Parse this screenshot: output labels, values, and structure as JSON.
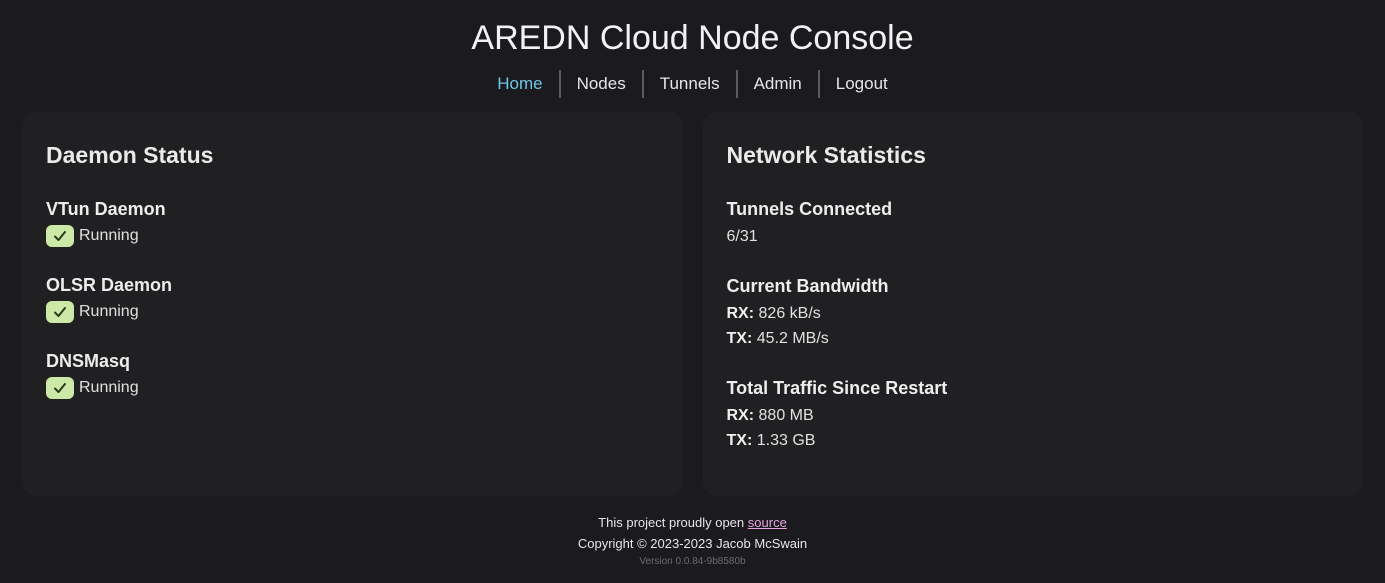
{
  "header": {
    "title": "AREDN Cloud Node Console"
  },
  "nav": {
    "items": [
      {
        "label": "Home"
      },
      {
        "label": "Nodes"
      },
      {
        "label": "Tunnels"
      },
      {
        "label": "Admin"
      },
      {
        "label": "Logout"
      }
    ],
    "active": "Home",
    "active_color": "#6ec6e4"
  },
  "daemon_status": {
    "title": "Daemon Status",
    "items": [
      {
        "name": "VTun Daemon",
        "status": "Running",
        "icon": "check-icon"
      },
      {
        "name": "OLSR Daemon",
        "status": "Running",
        "icon": "check-icon"
      },
      {
        "name": "DNSMasq",
        "status": "Running",
        "icon": "check-icon"
      }
    ],
    "status_color": "#cde9a8"
  },
  "network_stats": {
    "title": "Network Statistics",
    "tunnels_connected": {
      "heading": "Tunnels Connected",
      "value": "6/31"
    },
    "current_bandwidth": {
      "heading": "Current Bandwidth",
      "rx_label": "RX:",
      "rx_value": "826 kB/s",
      "tx_label": "TX:",
      "tx_value": "45.2 MB/s"
    },
    "total_traffic": {
      "heading": "Total Traffic Since Restart",
      "rx_label": "RX:",
      "rx_value": "880 MB",
      "tx_label": "TX:",
      "tx_value": "1.33 GB"
    }
  },
  "footer": {
    "project_text": "This project proudly open",
    "source_link": "source",
    "copyright": "Copyright © 2023-2023 Jacob McSwain",
    "version": "Version 0.0.84-9b8580b"
  }
}
